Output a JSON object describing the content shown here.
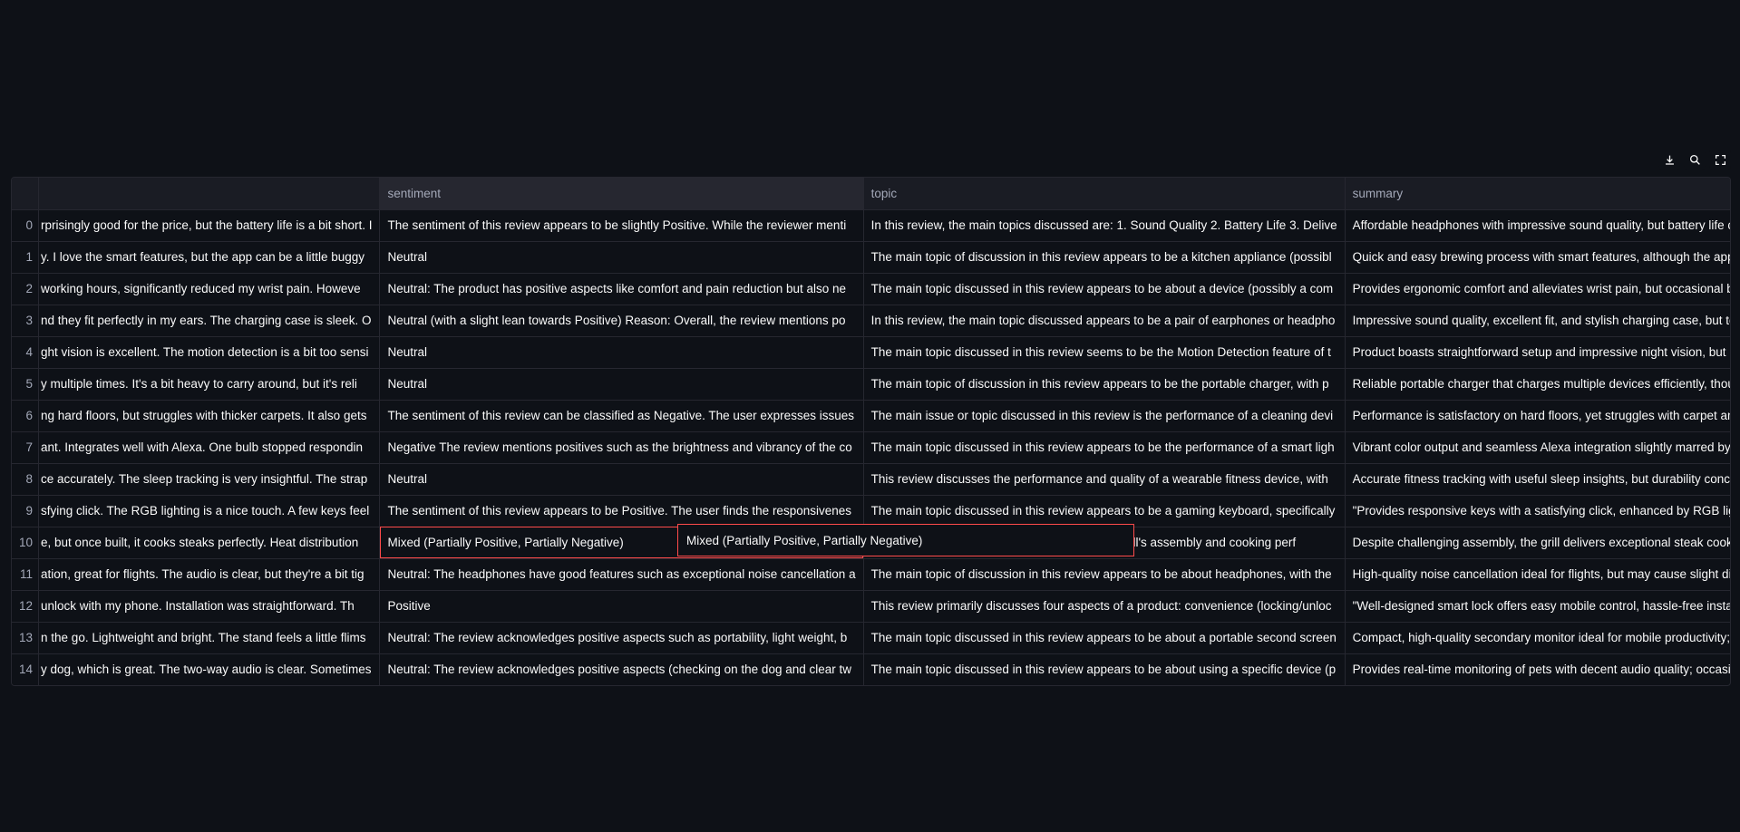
{
  "toolbar": {
    "download_icon": "download-icon",
    "search_icon": "search-icon",
    "fullscreen_icon": "fullscreen-icon"
  },
  "grid": {
    "columns": [
      "",
      "sentiment",
      "topic",
      "summary"
    ],
    "rows": [
      {
        "index": "0",
        "review": "rprisingly good for the price, but the battery life is a bit short. I",
        "sentiment": "The sentiment of this review appears to be slightly Positive. While the reviewer menti",
        "topic": "In this review, the main topics discussed are: 1. Sound Quality 2. Battery Life 3. Delive",
        "summary": "Affordable headphones with impressive sound quality, but battery life could be impro"
      },
      {
        "index": "1",
        "review": "y. I love the smart features, but the app can be a little buggy",
        "sentiment": "Neutral",
        "topic": "The main topic of discussion in this review appears to be a kitchen appliance (possibl",
        "summary": "Quick and easy brewing process with smart features, although the app could use som"
      },
      {
        "index": "2",
        "review": "working hours, significantly reduced my wrist pain. Howeve",
        "sentiment": "Neutral: The product has positive aspects like comfort and pain reduction but also ne",
        "topic": "The main topic discussed in this review appears to be about a device (possibly a com",
        "summary": "Provides ergonomic comfort and alleviates wrist pain, but occasional brief disconnec"
      },
      {
        "index": "3",
        "review": "nd they fit perfectly in my ears. The charging case is sleek. O",
        "sentiment": "Neutral (with a slight lean towards Positive)  Reason: Overall, the review mentions po",
        "topic": "In this review, the main topic discussed appears to be a pair of earphones or headpho",
        "summary": "Impressive sound quality, excellent fit, and stylish charging case, but touch controls c"
      },
      {
        "index": "4",
        "review": "ght vision is excellent. The motion detection is a bit too sensi",
        "sentiment": "Neutral",
        "topic": "The main topic discussed in this review seems to be the Motion Detection feature of t",
        "summary": "Product boasts straightforward setup and impressive night vision, but its overly sensi"
      },
      {
        "index": "5",
        "review": "y multiple times. It's a bit heavy to carry around, but it's reli",
        "sentiment": "Neutral",
        "topic": "The main topic of discussion in this review appears to be the portable charger, with p",
        "summary": "Reliable portable charger that charges multiple devices efficiently, though somewhat"
      },
      {
        "index": "6",
        "review": "ng hard floors, but struggles with thicker carpets. It also gets",
        "sentiment": "The sentiment of this review can be classified as Negative. The user expresses issues",
        "topic": "The main issue or topic discussed in this review is the performance of a cleaning devi",
        "summary": "Performance is satisfactory on hard floors, yet struggles with carpet and frequently g"
      },
      {
        "index": "7",
        "review": "ant. Integrates well with Alexa. One bulb stopped respondin",
        "sentiment": "Negative  The review mentions positives such as the brightness and vibrancy of the co",
        "topic": "The main topic discussed in this review appears to be the performance of a smart ligh",
        "summary": "Vibrant color output and seamless Alexa integration slightly marred by occasional bu"
      },
      {
        "index": "8",
        "review": "ce accurately. The sleep tracking is very insightful. The strap",
        "sentiment": "Neutral",
        "topic": "This review discusses the performance and quality of a wearable fitness device, with",
        "summary": "Accurate fitness tracking with useful sleep insights, but durability concerns arise with"
      },
      {
        "index": "9",
        "review": "sfying click. The RGB lighting is a nice touch. A few keys feel",
        "sentiment": "The sentiment of this review appears to be Positive. The user finds the responsivenes",
        "topic": "The main topic discussed in this review appears to be a gaming keyboard, specifically",
        "summary": "\"Provides responsive keys with a satisfying click, enhanced by RGB lighting; minor ke"
      },
      {
        "index": "10",
        "review": "e, but once built, it cooks steaks perfectly. Heat distribution",
        "sentiment": "Mixed (Partially Positive, Partially Negative)",
        "topic": "The main topic discussed in this review is the grill's assembly and cooking perf",
        "summary": "Despite challenging assembly, the grill delivers exceptional steak cooking with impre"
      },
      {
        "index": "11",
        "review": "ation, great for flights. The audio is clear, but they're a bit tig",
        "sentiment": "Neutral: The headphones have good features such as exceptional noise cancellation a",
        "topic": "The main topic of discussion in this review appears to be about headphones, with the",
        "summary": "High-quality noise cancellation ideal for flights, but may cause slight discomfort due"
      },
      {
        "index": "12",
        "review": "unlock with my phone. Installation was straightforward. Th",
        "sentiment": "Positive",
        "topic": "This review primarily discusses four aspects of a product: convenience (locking/unloc",
        "summary": "\"Well-designed smart lock offers easy mobile control, hassle-free installation, and im"
      },
      {
        "index": "13",
        "review": "n the go. Lightweight and bright. The stand feels a little flims",
        "sentiment": "Neutral: The review acknowledges positive aspects such as portability, light weight, b",
        "topic": "The main topic discussed in this review appears to be about a portable second screen",
        "summary": "Compact, high-quality secondary monitor ideal for mobile productivity; slight constru"
      },
      {
        "index": "14",
        "review": "y dog, which is great. The two-way audio is clear. Sometimes",
        "sentiment": "Neutral: The review acknowledges positive aspects (checking on the dog and clear tw",
        "topic": "The main topic discussed in this review appears to be about using a specific device (p",
        "summary": "Provides real-time monitoring of pets with decent audio quality; occasional connecti"
      }
    ],
    "editor_value": "Mixed (Partially Positive, Partially Negative)"
  },
  "colors": {
    "background": "#0e1117",
    "header": "#1a1c24",
    "border": "#262730",
    "selection": "#ff4b4b",
    "text": "#fafafa",
    "muted": "#a3a8b8"
  }
}
